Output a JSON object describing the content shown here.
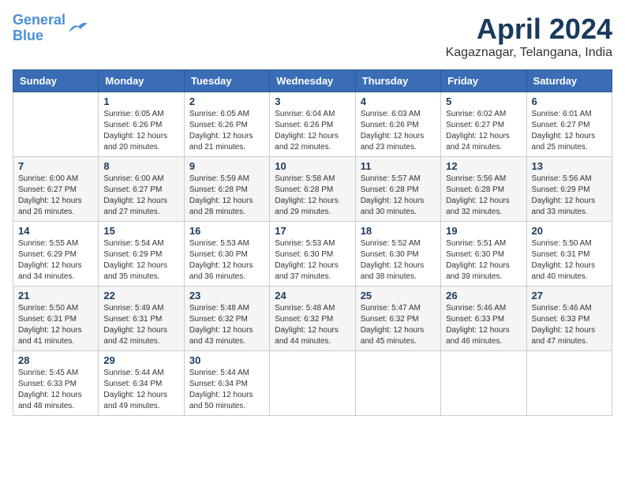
{
  "logo": {
    "line1": "General",
    "line2": "Blue"
  },
  "title": "April 2024",
  "subtitle": "Kagaznagar, Telangana, India",
  "days_header": [
    "Sunday",
    "Monday",
    "Tuesday",
    "Wednesday",
    "Thursday",
    "Friday",
    "Saturday"
  ],
  "weeks": [
    [
      {
        "day": "",
        "info": ""
      },
      {
        "day": "1",
        "info": "Sunrise: 6:05 AM\nSunset: 6:26 PM\nDaylight: 12 hours\nand 20 minutes."
      },
      {
        "day": "2",
        "info": "Sunrise: 6:05 AM\nSunset: 6:26 PM\nDaylight: 12 hours\nand 21 minutes."
      },
      {
        "day": "3",
        "info": "Sunrise: 6:04 AM\nSunset: 6:26 PM\nDaylight: 12 hours\nand 22 minutes."
      },
      {
        "day": "4",
        "info": "Sunrise: 6:03 AM\nSunset: 6:26 PM\nDaylight: 12 hours\nand 23 minutes."
      },
      {
        "day": "5",
        "info": "Sunrise: 6:02 AM\nSunset: 6:27 PM\nDaylight: 12 hours\nand 24 minutes."
      },
      {
        "day": "6",
        "info": "Sunrise: 6:01 AM\nSunset: 6:27 PM\nDaylight: 12 hours\nand 25 minutes."
      }
    ],
    [
      {
        "day": "7",
        "info": "Sunrise: 6:00 AM\nSunset: 6:27 PM\nDaylight: 12 hours\nand 26 minutes."
      },
      {
        "day": "8",
        "info": "Sunrise: 6:00 AM\nSunset: 6:27 PM\nDaylight: 12 hours\nand 27 minutes."
      },
      {
        "day": "9",
        "info": "Sunrise: 5:59 AM\nSunset: 6:28 PM\nDaylight: 12 hours\nand 28 minutes."
      },
      {
        "day": "10",
        "info": "Sunrise: 5:58 AM\nSunset: 6:28 PM\nDaylight: 12 hours\nand 29 minutes."
      },
      {
        "day": "11",
        "info": "Sunrise: 5:57 AM\nSunset: 6:28 PM\nDaylight: 12 hours\nand 30 minutes."
      },
      {
        "day": "12",
        "info": "Sunrise: 5:56 AM\nSunset: 6:28 PM\nDaylight: 12 hours\nand 32 minutes."
      },
      {
        "day": "13",
        "info": "Sunrise: 5:56 AM\nSunset: 6:29 PM\nDaylight: 12 hours\nand 33 minutes."
      }
    ],
    [
      {
        "day": "14",
        "info": "Sunrise: 5:55 AM\nSunset: 6:29 PM\nDaylight: 12 hours\nand 34 minutes."
      },
      {
        "day": "15",
        "info": "Sunrise: 5:54 AM\nSunset: 6:29 PM\nDaylight: 12 hours\nand 35 minutes."
      },
      {
        "day": "16",
        "info": "Sunrise: 5:53 AM\nSunset: 6:30 PM\nDaylight: 12 hours\nand 36 minutes."
      },
      {
        "day": "17",
        "info": "Sunrise: 5:53 AM\nSunset: 6:30 PM\nDaylight: 12 hours\nand 37 minutes."
      },
      {
        "day": "18",
        "info": "Sunrise: 5:52 AM\nSunset: 6:30 PM\nDaylight: 12 hours\nand 38 minutes."
      },
      {
        "day": "19",
        "info": "Sunrise: 5:51 AM\nSunset: 6:30 PM\nDaylight: 12 hours\nand 39 minutes."
      },
      {
        "day": "20",
        "info": "Sunrise: 5:50 AM\nSunset: 6:31 PM\nDaylight: 12 hours\nand 40 minutes."
      }
    ],
    [
      {
        "day": "21",
        "info": "Sunrise: 5:50 AM\nSunset: 6:31 PM\nDaylight: 12 hours\nand 41 minutes."
      },
      {
        "day": "22",
        "info": "Sunrise: 5:49 AM\nSunset: 6:31 PM\nDaylight: 12 hours\nand 42 minutes."
      },
      {
        "day": "23",
        "info": "Sunrise: 5:48 AM\nSunset: 6:32 PM\nDaylight: 12 hours\nand 43 minutes."
      },
      {
        "day": "24",
        "info": "Sunrise: 5:48 AM\nSunset: 6:32 PM\nDaylight: 12 hours\nand 44 minutes."
      },
      {
        "day": "25",
        "info": "Sunrise: 5:47 AM\nSunset: 6:32 PM\nDaylight: 12 hours\nand 45 minutes."
      },
      {
        "day": "26",
        "info": "Sunrise: 5:46 AM\nSunset: 6:33 PM\nDaylight: 12 hours\nand 46 minutes."
      },
      {
        "day": "27",
        "info": "Sunrise: 5:46 AM\nSunset: 6:33 PM\nDaylight: 12 hours\nand 47 minutes."
      }
    ],
    [
      {
        "day": "28",
        "info": "Sunrise: 5:45 AM\nSunset: 6:33 PM\nDaylight: 12 hours\nand 48 minutes."
      },
      {
        "day": "29",
        "info": "Sunrise: 5:44 AM\nSunset: 6:34 PM\nDaylight: 12 hours\nand 49 minutes."
      },
      {
        "day": "30",
        "info": "Sunrise: 5:44 AM\nSunset: 6:34 PM\nDaylight: 12 hours\nand 50 minutes."
      },
      {
        "day": "",
        "info": ""
      },
      {
        "day": "",
        "info": ""
      },
      {
        "day": "",
        "info": ""
      },
      {
        "day": "",
        "info": ""
      }
    ]
  ]
}
